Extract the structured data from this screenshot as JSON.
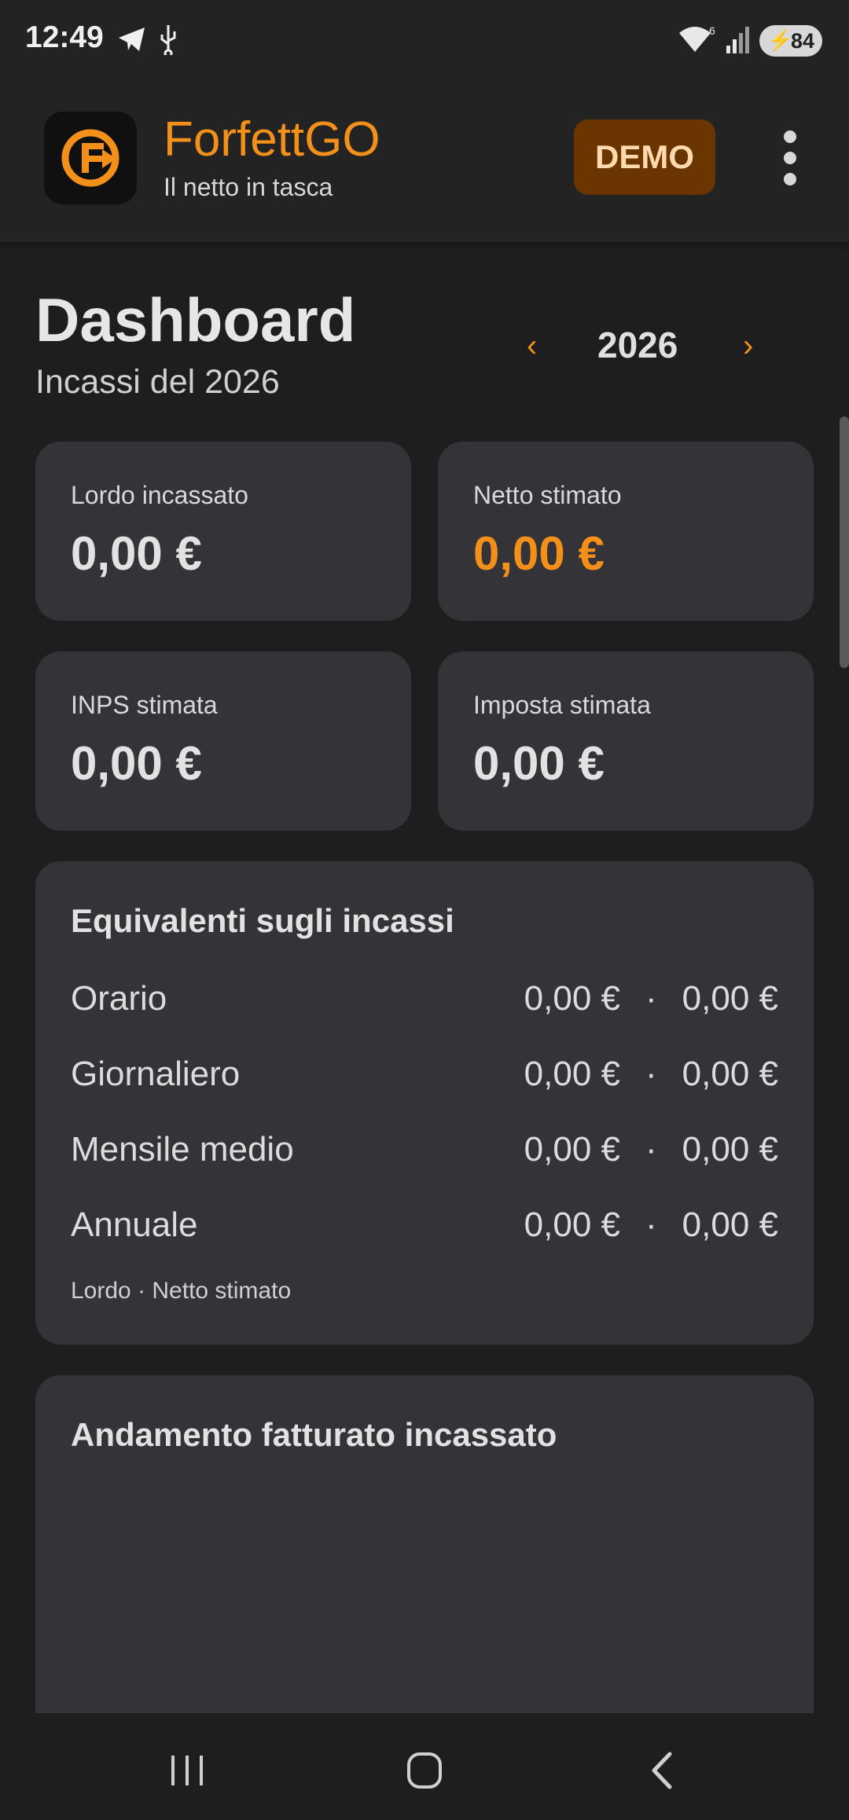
{
  "status_bar": {
    "time": "12:49",
    "battery": "84",
    "icons": [
      "telegram-icon",
      "usb-icon",
      "wifi-icon",
      "signal-icon",
      "battery-charging-icon"
    ]
  },
  "app_bar": {
    "app_name": "ForfettGO",
    "tagline": "Il netto in tasca",
    "demo_label": "DEMO",
    "brand_color": "#f39019"
  },
  "header": {
    "title": "Dashboard",
    "subtitle": "Incassi del 2026",
    "year": "2026",
    "prev_glyph": "‹",
    "next_glyph": "›"
  },
  "stats": [
    {
      "label": "Lordo incassato",
      "value": "0,00 €"
    },
    {
      "label": "Netto stimato",
      "value": "0,00 €"
    },
    {
      "label": "INPS stimata",
      "value": "0,00 €"
    },
    {
      "label": "Imposta stimata",
      "value": "0,00 €"
    }
  ],
  "equivalents": {
    "title": "Equivalenti sugli incassi",
    "rows": [
      {
        "label": "Orario",
        "gross": "0,00 €",
        "net": "0,00 €"
      },
      {
        "label": "Giornaliero",
        "gross": "0,00 €",
        "net": "0,00 €"
      },
      {
        "label": "Mensile medio",
        "gross": "0,00 €",
        "net": "0,00 €"
      },
      {
        "label": "Annuale",
        "gross": "0,00 €",
        "net": "0,00 €"
      }
    ],
    "separator": "·",
    "footnote": "Lordo · Netto stimato"
  },
  "chart_card": {
    "title": "Andamento fatturato incassato"
  }
}
